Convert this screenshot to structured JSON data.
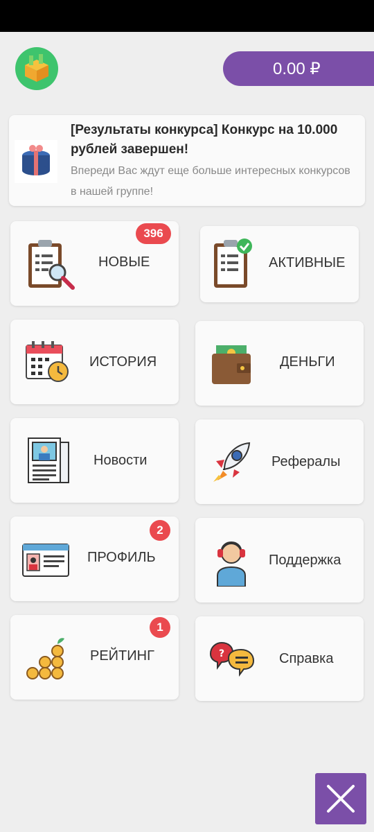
{
  "balance": {
    "amount": "0.00 ₽"
  },
  "news": {
    "title": "[Результаты конкурса] Конкурс на 10.000 рублей завершен!",
    "text": "Впереди Вас ждут еще больше интересных конкурсов в нашей группе!"
  },
  "tiles": {
    "new": {
      "label": "НОВЫЕ",
      "badge": "396"
    },
    "active": {
      "label": "АКТИВНЫЕ"
    },
    "history": {
      "label": "ИСТОРИЯ"
    },
    "money": {
      "label": "ДЕНЬГИ"
    },
    "news": {
      "label": "Новости"
    },
    "referrals": {
      "label": "Рефералы"
    },
    "profile": {
      "label": "ПРОФИЛЬ",
      "badge": "2"
    },
    "support": {
      "label": "Поддержка"
    },
    "rating": {
      "label": "РЕЙТИНГ",
      "badge": "1"
    },
    "help": {
      "label": "Справка"
    }
  },
  "colors": {
    "accent": "#7b4fa8",
    "badge": "#ea4a4f",
    "logo_bg": "#3ec46d"
  },
  "icons": {
    "logo": "gift-box-icon",
    "close": "close-icon"
  }
}
